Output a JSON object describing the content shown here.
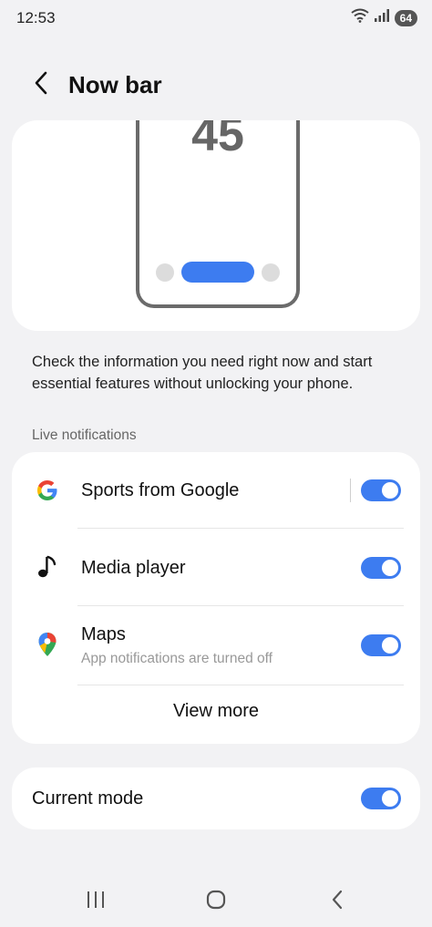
{
  "status_bar": {
    "time": "12:53",
    "battery": "64"
  },
  "header": {
    "title": "Now bar"
  },
  "preview": {
    "number": "45"
  },
  "description": "Check the information you need right now and start essential features without unlocking your phone.",
  "section_label": "Live notifications",
  "notifications": [
    {
      "title": "Sports from Google",
      "icon": "google-icon",
      "enabled": true
    },
    {
      "title": "Media player",
      "icon": "music-note-icon",
      "enabled": true
    },
    {
      "title": "Maps",
      "subtitle": "App notifications are turned off",
      "icon": "maps-pin-icon",
      "enabled": true
    }
  ],
  "view_more_label": "View more",
  "current_mode": {
    "label": "Current mode",
    "enabled": true
  },
  "colors": {
    "accent": "#3d7cf0",
    "background": "#f2f2f4",
    "card": "#ffffff"
  }
}
